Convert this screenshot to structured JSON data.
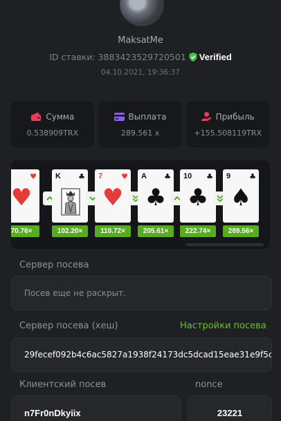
{
  "user": {
    "name": "MaksatMe"
  },
  "bet": {
    "id_text": "ID ставки: 3883423529720501",
    "verified_label": "Verified",
    "datetime": "04.10.2021, 19:36:37"
  },
  "stats": [
    {
      "label": "Сумма",
      "value": "0.538909TRX",
      "icon": "wallet-icon",
      "color": "#e0405a"
    },
    {
      "label": "Выплата",
      "value": "289.561 x",
      "icon": "card-icon",
      "color": "#8a5cf0"
    },
    {
      "label": "Прибыль",
      "value": "+155.508119TRX",
      "icon": "profit-icon",
      "color": "#e0405a"
    }
  ],
  "cards": [
    {
      "rank": "",
      "suit": "heart",
      "color": "red",
      "multiplier": "70.76×"
    },
    {
      "rank": "K",
      "suit": "club",
      "color": "black",
      "multiplier": "102.20×"
    },
    {
      "rank": "7",
      "suit": "heart",
      "color": "red",
      "multiplier": "110.72×"
    },
    {
      "rank": "A",
      "suit": "club",
      "color": "black",
      "multiplier": "205.61×"
    },
    {
      "rank": "10",
      "suit": "club",
      "color": "black",
      "multiplier": "222.74×"
    },
    {
      "rank": "9",
      "suit": "spade",
      "color": "black",
      "multiplier": "289.56×"
    }
  ],
  "arrows": [
    "up",
    "down",
    "double-down",
    "up",
    "double-down"
  ],
  "seeds": {
    "server_label": "Сервер посева",
    "server_value": "Посев еще не раскрыт.",
    "server_hash_label": "Сервер посева (хеш)",
    "settings_link": "Настройки посева",
    "server_hash_value": "29fecef092b4c6ac5827a1938f24173dc5dcad15eae31e9f5c",
    "client_label": "Клиентский посев",
    "client_value": "n7Fr0nDkyiix",
    "nonce_label": "nonce",
    "nonce_value": "23221"
  },
  "colors": {
    "accent_green": "#57ad1e",
    "link_green": "#6cbf28",
    "verified_green": "#3fc24a"
  }
}
